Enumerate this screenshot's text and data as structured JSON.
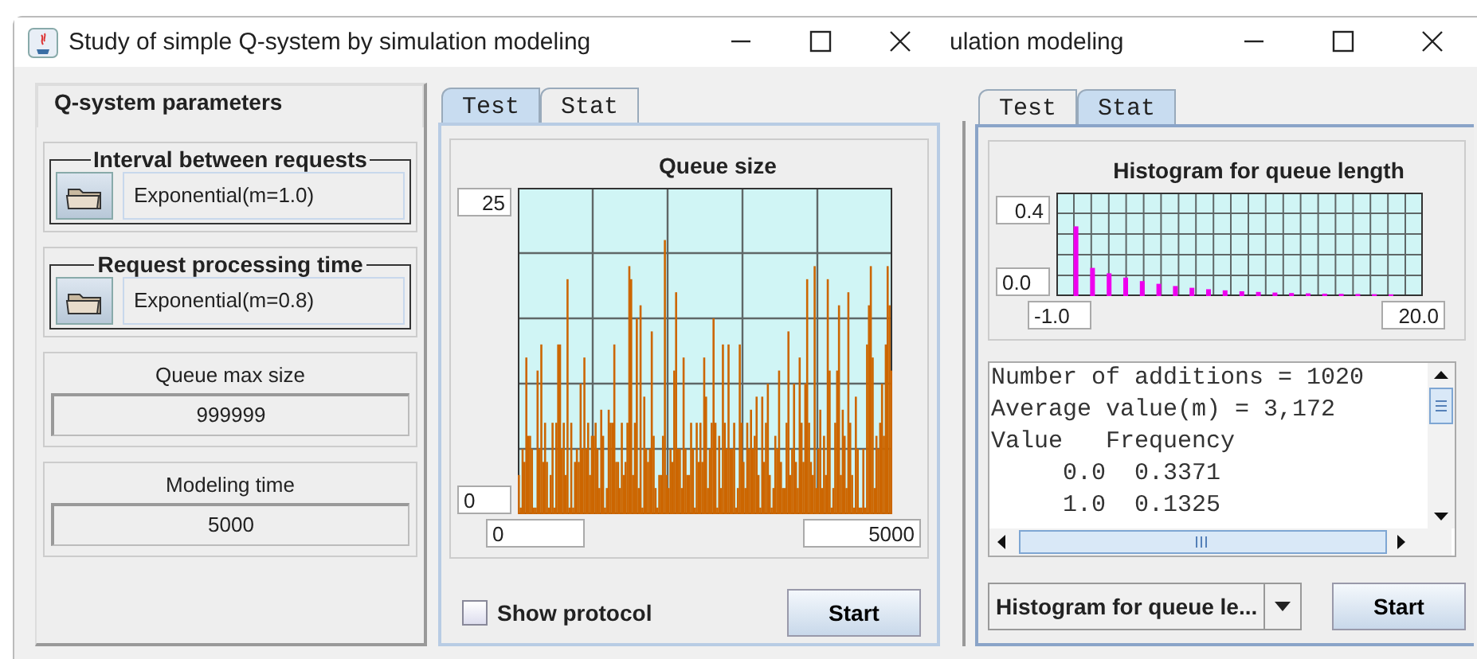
{
  "windows": [
    {
      "title": "Study of simple Q-system by simulation modeling",
      "parameters": {
        "title": "Q-system parameters",
        "distributions": [
          {
            "label": "Interval between requests",
            "value": "Exponential(m=1.0)"
          },
          {
            "label": "Request processing time",
            "value": "Exponential(m=0.8)"
          }
        ],
        "fields": [
          {
            "label": "Queue max size",
            "value": "999999"
          },
          {
            "label": "Modeling time",
            "value": "5000"
          }
        ]
      },
      "tabs": [
        {
          "label": "Test",
          "selected": true
        },
        {
          "label": "Stat",
          "selected": false
        }
      ],
      "chart": {
        "kind": "queue",
        "title": "Queue size",
        "y_max": "25",
        "y_min": "0",
        "x_min": "0",
        "x_max": "5000"
      },
      "show_protocol": {
        "label": "Show protocol",
        "checked": false
      },
      "start_button": "Start"
    },
    {
      "title": "ulation modeling",
      "tabs": [
        {
          "label": "Test",
          "selected": false
        },
        {
          "label": "Stat",
          "selected": true
        }
      ],
      "chart": {
        "kind": "histogram",
        "title": "Histogram for queue length",
        "y_max": "0.4",
        "y_min": "0.0",
        "x_min": "-1.0",
        "x_max": "20.0"
      },
      "output_lines": [
        "Number of additions = 1020",
        "Average value(m) = 3,172",
        "Value   Frequency",
        "     0.0  0.3371",
        "     1.0  0.1325"
      ],
      "plot_selector": "Histogram for queue le...",
      "start_button": "Start"
    }
  ]
}
